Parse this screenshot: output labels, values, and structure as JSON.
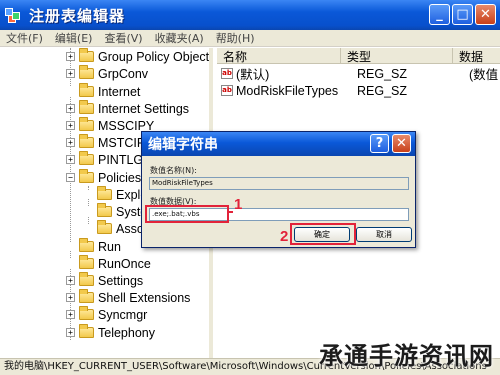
{
  "window": {
    "title": "注册表编辑器",
    "min": "_",
    "max": "□",
    "close": "✕"
  },
  "menu": [
    "文件(F)",
    "编辑(E)",
    "查看(V)",
    "收藏夹(A)",
    "帮助(H)"
  ],
  "tree": [
    {
      "label": "Group Policy Object",
      "exp": "+"
    },
    {
      "label": "GrpConv",
      "exp": "+"
    },
    {
      "label": "Internet",
      "exp": ""
    },
    {
      "label": "Internet Settings",
      "exp": "+"
    },
    {
      "label": "MSSCIPY",
      "exp": "+"
    },
    {
      "label": "MSTCIPH",
      "exp": "+"
    },
    {
      "label": "PINTLGN",
      "exp": "+"
    },
    {
      "label": "Policies",
      "exp": "−"
    },
    {
      "label": "Explo",
      "exp": ""
    },
    {
      "label": "Syste",
      "exp": ""
    },
    {
      "label": "Assoc",
      "exp": ""
    },
    {
      "label": "Run",
      "exp": ""
    },
    {
      "label": "RunOnce",
      "exp": ""
    },
    {
      "label": "Settings",
      "exp": "+"
    },
    {
      "label": "Shell Extensions",
      "exp": "+"
    },
    {
      "label": "Syncmgr",
      "exp": "+"
    },
    {
      "label": "Telephony",
      "exp": "+"
    }
  ],
  "list": {
    "headers": [
      "名称",
      "类型",
      "数据"
    ],
    "rows": [
      {
        "name": "(默认)",
        "type": "REG_SZ",
        "data": "(数值"
      },
      {
        "name": "ModRiskFileTypes",
        "type": "REG_SZ",
        "data": ""
      }
    ]
  },
  "dialog": {
    "title": "编辑字符串",
    "help": "?",
    "close": "✕",
    "name_label": "数值名称(N):",
    "name_value": "ModRiskFileTypes",
    "data_label": "数值数据(V):",
    "data_value": ".exe;.bat;.vbs",
    "ok": "确定",
    "cancel": "取消"
  },
  "annotations": {
    "one": "1",
    "two": "2"
  },
  "status": "我的电脑\\HKEY_CURRENT_USER\\Software\\Microsoft\\Windows\\CurrentVersion\\Policies\\Associations",
  "watermark": "承通手游资讯网",
  "colors": {
    "title_blue": "#0a58d8",
    "chrome": "#ece9d8",
    "annotation_red": "#e2233a"
  }
}
